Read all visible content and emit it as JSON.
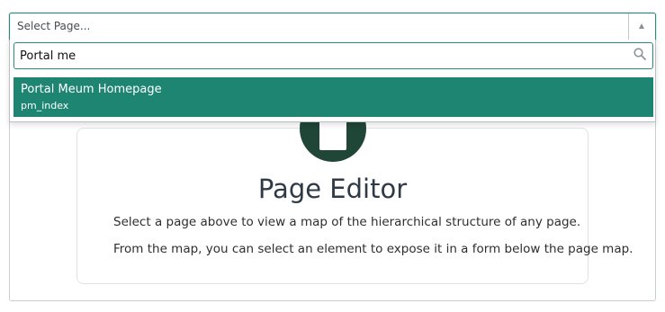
{
  "select": {
    "label": "Select Page..."
  },
  "search": {
    "value": "Portal me"
  },
  "results": [
    {
      "title": "Portal Meum Homepage",
      "id": "pm_index"
    }
  ],
  "editor": {
    "title": "Page Editor",
    "line1": "Select a page above to view a map of the hierarchical structure of any page.",
    "line2": "From the map, you can select an element to expose it in a form below the page map."
  },
  "colors": {
    "accent": "#1f8573",
    "icon_circle": "#1f4637"
  },
  "icons": {
    "select_arrow": "caret-up-icon",
    "search": "search-icon",
    "editor": "document-icon"
  }
}
